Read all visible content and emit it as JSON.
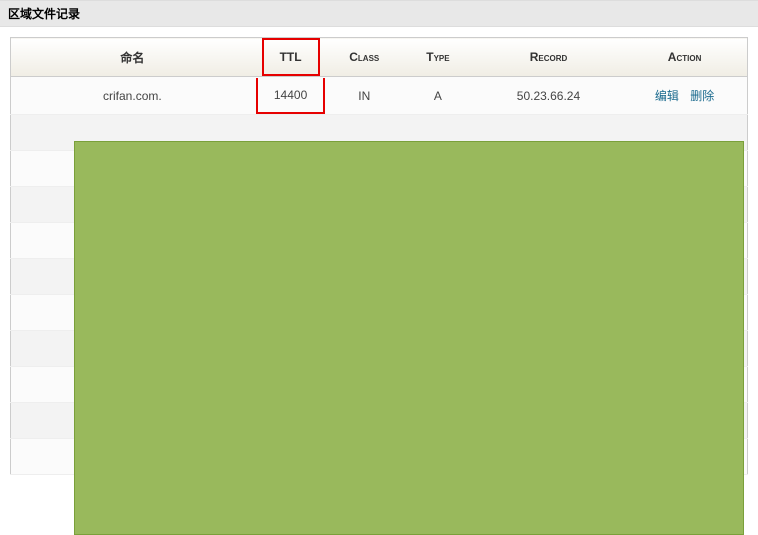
{
  "section_title": "区域文件记录",
  "columns": {
    "name": "命名",
    "ttl": "TTL",
    "cls": "Class",
    "type": "Type",
    "record": "Record",
    "action": "Action"
  },
  "row": {
    "name": "crifan.com.",
    "ttl": "14400",
    "cls": "IN",
    "type": "A",
    "record": "50.23.66.24",
    "edit": "编辑",
    "delete": "删除"
  }
}
